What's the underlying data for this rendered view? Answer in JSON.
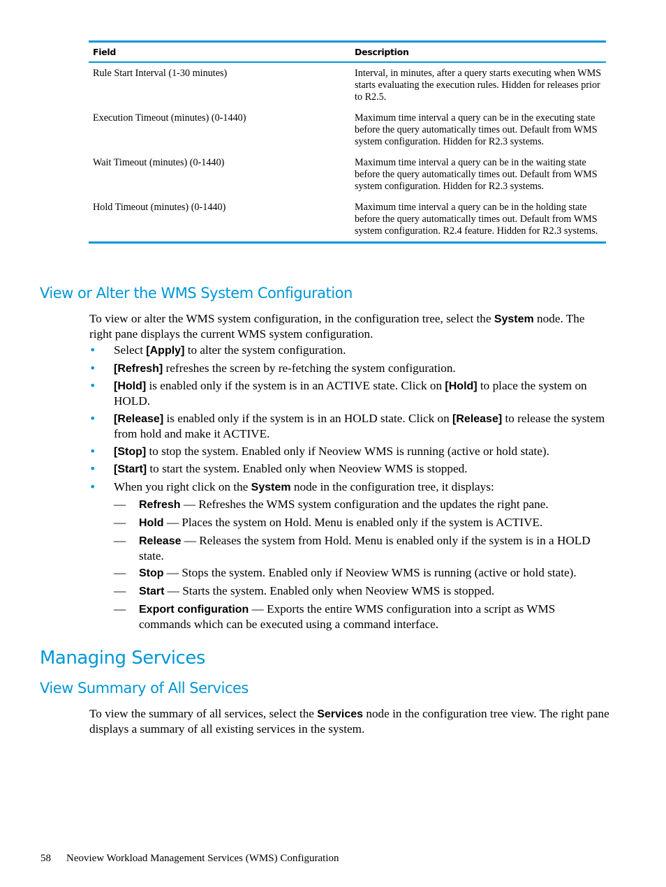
{
  "table": {
    "headers": [
      "Field",
      "Description"
    ],
    "rows": [
      {
        "field": "Rule Start Interval (1-30 minutes)",
        "description": "Interval, in minutes, after a query starts executing when WMS starts evaluating the execution rules. Hidden for releases prior to R2.5."
      },
      {
        "field": "Execution Timeout (minutes) (0-1440)",
        "description": "Maximum time interval a query can be in the executing state before the query automatically times out. Default from WMS system configuration. Hidden for R2.3 systems."
      },
      {
        "field": "Wait Timeout (minutes) (0-1440)",
        "description": "Maximum time interval a query can be in the waiting state before the query automatically times out. Default from WMS system configuration. Hidden for R2.3 systems."
      },
      {
        "field": "Hold Timeout (minutes) (0-1440)",
        "description": "Maximum time interval a query can be in the holding state before the query automatically times out. Default from WMS system configuration. R2.4 feature. Hidden for R2.3 systems."
      }
    ]
  },
  "section1": {
    "heading": "View or Alter the WMS System Configuration",
    "intro": {
      "pre": "To view or alter the WMS system configuration, in the configuration tree, select the ",
      "bold": "System",
      "post": " node. The right pane displays the current WMS system configuration."
    },
    "bullets": [
      {
        "pre": "Select ",
        "bold": "[Apply]",
        "post": " to alter the system configuration."
      },
      {
        "pre": "",
        "bold": "[Refresh]",
        "post": " refreshes the screen by re-fetching the system configuration."
      },
      {
        "pre": "",
        "bold": "[Hold]",
        "post": " is enabled only if the system is in an ACTIVE state. Click on ",
        "bold2": "[Hold]",
        "post2": " to place the system on HOLD."
      },
      {
        "pre": "",
        "bold": "[Release]",
        "post": " is enabled only if the system is in an HOLD state. Click on ",
        "bold2": "[Release]",
        "post2": " to release the system from hold and make it ACTIVE."
      },
      {
        "pre": "",
        "bold": "[Stop]",
        "post": " to stop the system. Enabled only if Neoview WMS is running (active or hold state)."
      },
      {
        "pre": "",
        "bold": "[Start]",
        "post": " to start the system. Enabled only when Neoview WMS is stopped."
      },
      {
        "pre": "When you right click on the ",
        "bold": "System",
        "post": " node in the configuration tree, it displays:"
      }
    ],
    "sub_items": [
      {
        "bold": "Refresh",
        "text": " — Refreshes the WMS system configuration and the updates the right pane."
      },
      {
        "bold": "Hold",
        "text": " — Places the system on Hold. Menu is enabled only if the system is ACTIVE."
      },
      {
        "bold": "Release",
        "text": " — Releases the system from Hold. Menu is enabled only if the system is in a HOLD state."
      },
      {
        "bold": "Stop",
        "text": " — Stops the system. Enabled only if Neoview WMS is running (active or hold state)."
      },
      {
        "bold": "Start",
        "text": " — Starts the system. Enabled only when Neoview WMS is stopped."
      },
      {
        "bold": "Export configuration",
        "text": " — Exports the entire WMS configuration into a script as WMS commands which can be executed using a command interface."
      }
    ]
  },
  "section2": {
    "heading": "Managing Services",
    "subheading": "View Summary of All Services",
    "intro": {
      "pre": "To view the summary of all services, select the ",
      "bold": "Services",
      "post": " node in the configuration tree view. The right pane displays a summary of all existing services in the system."
    }
  },
  "footer": {
    "page_number": "58",
    "title": "Neoview Workload Management Services (WMS) Configuration"
  },
  "glyphs": {
    "bullet": "•",
    "dash": "—"
  },
  "colors": {
    "accent": "#0096d6"
  }
}
